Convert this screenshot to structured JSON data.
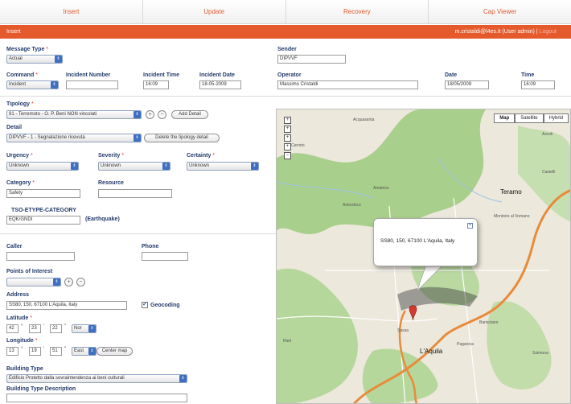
{
  "nav": {
    "tabs": [
      "Insert",
      "Update",
      "Recovery",
      "Cap Viewer"
    ]
  },
  "bar": {
    "title": "Insert",
    "user": "m.cristaldi@l4es.it (User admin) | ",
    "logout": "Logout"
  },
  "form": {
    "message_type": {
      "label": "Message Type",
      "value": "Actual"
    },
    "sender": {
      "label": "Sender",
      "value": "DIPVVF"
    },
    "command": {
      "label": "Command",
      "value": "Incident"
    },
    "incident_number": {
      "label": "Incident Number",
      "value": ""
    },
    "incident_time": {
      "label": "Incident Time",
      "value": "16:09"
    },
    "incident_date": {
      "label": "Incident Date",
      "value": "18-05-2009"
    },
    "operator": {
      "label": "Operator",
      "value": "Massimo Cristaldi"
    },
    "date": {
      "label": "Date",
      "value": "18/05/2009"
    },
    "time": {
      "label": "Time",
      "value": "16:09"
    },
    "typology": {
      "label": "Tipology",
      "value": "91 - Terremoto - O. P. Beni NON vincolati",
      "add_label": "Add Detail"
    },
    "detail": {
      "label": "Detail",
      "value": "DIPVVF - 1 - Segnalazione ricevuta",
      "delete_label": "Delete the tipology detail"
    },
    "urgency": {
      "label": "Urgency",
      "value": "Unknown"
    },
    "severity": {
      "label": "Severity",
      "value": "Unknown"
    },
    "certainty": {
      "label": "Certainty",
      "value": "Unknown"
    },
    "category": {
      "label": "Category",
      "value": "Safety"
    },
    "resource": {
      "label": "Resource",
      "value": ""
    },
    "tso": {
      "label": "TSO-ETYPE-CATEGORY",
      "value": "EQK/GNDI",
      "note": "(Earthquake)"
    },
    "caller": {
      "label": "Caller",
      "value": ""
    },
    "phone": {
      "label": "Phone",
      "value": ""
    },
    "poi": {
      "label": "Points of Interest",
      "value": ""
    },
    "address": {
      "label": "Address",
      "value": "SS80, 150, 67100 L'Aquila, Italy"
    },
    "geocoding": {
      "label": "Geocoding",
      "checked": "✔"
    },
    "latitude": {
      "label": "Latitude",
      "deg": "42",
      "min": "23",
      "sec": "22",
      "dir": "Nor"
    },
    "longitude": {
      "label": "Longitude",
      "deg": "13",
      "min": "19",
      "sec": "51",
      "dir": "East",
      "center_label": "Center map"
    },
    "building_type": {
      "label": "Building Type",
      "value": "Edificio Protetto dalla sovraintendenza ai beni culturali"
    },
    "building_desc": {
      "label": "Building Type Description",
      "value": ""
    },
    "symbols": {
      "plus": "+",
      "minus": "−",
      "deg": "°",
      "min": "'",
      "sec": "\"",
      "arrow": "⇕"
    }
  },
  "map": {
    "buttons": [
      "Map",
      "Satellite",
      "Hybrid"
    ],
    "zoom": [
      "+",
      "+",
      "+",
      "+",
      "−"
    ],
    "bubble_text": "SS80, 150, 67100 L'Aquila, Italy",
    "bubble_close": "×",
    "places": [
      "Acquasanta",
      "Teramo",
      "Castelli",
      "L'Aquila",
      "Sulmona",
      "Amatrice",
      "Rieti",
      "Antrodoco",
      "Sassa",
      "Paganica",
      "Barisciano",
      "Cerreto",
      "Montorio al Vomano",
      "Ascoli"
    ],
    "colors": {
      "land": "#ece8dc",
      "green": "#a9cf8c",
      "road": "#e78b3b",
      "river": "#9cc0e6"
    }
  }
}
